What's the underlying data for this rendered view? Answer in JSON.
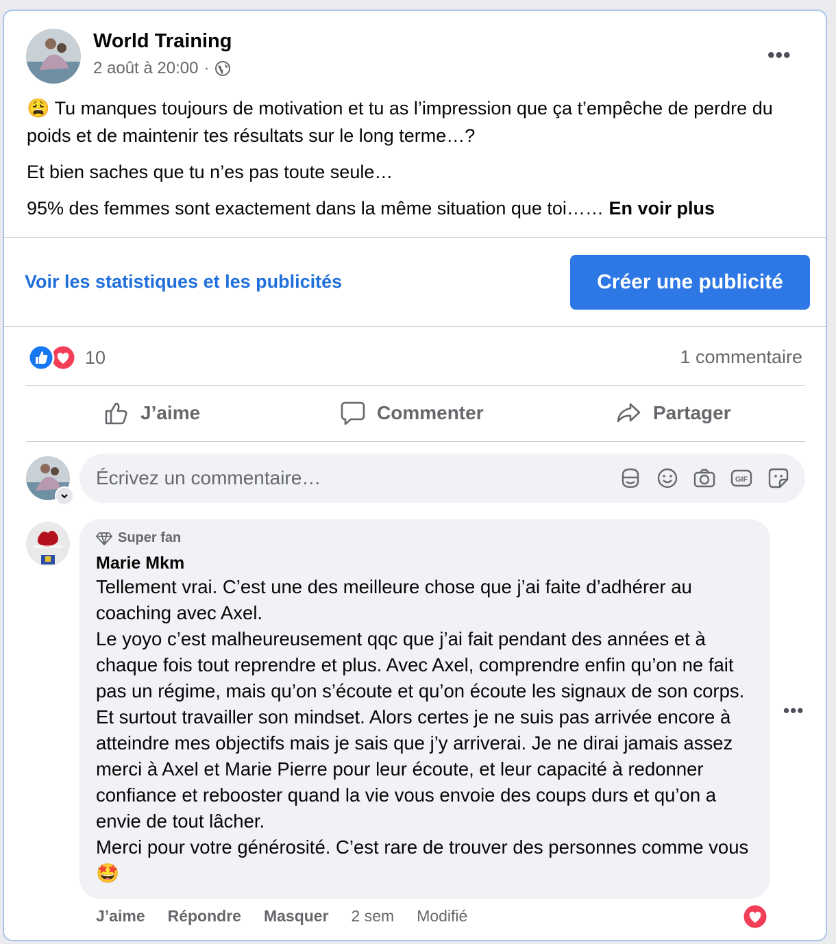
{
  "post": {
    "page_name": "World Training",
    "date": "2 août à 20:00",
    "separator": "·",
    "more_icon": "•••",
    "emoji_start": "😩",
    "paragraphs": [
      " Tu manques toujours de motivation et tu as l’impression que ça t’empêche de perdre du poids et de maintenir tes résultats sur le long terme…?",
      "Et bien saches que tu n’es pas toute seule…",
      "95% des femmes sont exactement dans la même situation que toi……"
    ],
    "see_more": "En voir plus"
  },
  "promo": {
    "stats_link": "Voir les statistiques et les publicités",
    "create_ad_button": "Créer une publicité"
  },
  "reactions": {
    "count": "10",
    "comments_count": "1 commentaire"
  },
  "actions": {
    "like": "J’aime",
    "comment": "Commenter",
    "share": "Partager"
  },
  "composer": {
    "placeholder": "Écrivez un commentaire…"
  },
  "comment": {
    "badge": "Super fan",
    "author": "Marie Mkm",
    "text": "Tellement vrai. C’est une des meilleure chose que j’ai faite d’adhérer au coaching avec Axel.\nLe yoyo c’est malheureusement qqc que j’ai fait pendant des années et à chaque fois tout reprendre et plus. Avec Axel, comprendre enfin qu’on ne fait pas un régime, mais qu’on s’écoute et qu’on écoute les signaux de son corps. Et surtout travailler son mindset. Alors certes je ne suis pas arrivée encore à atteindre mes objectifs mais je sais que j’y arriverai. Je ne dirai jamais assez merci à Axel et Marie Pierre pour leur écoute, et leur capacité à redonner confiance et rebooster quand la vie vous envoie des coups durs et qu’on a envie de tout lâcher.\nMerci pour votre générosité. C’est rare de trouver des personnes comme vous",
    "emoji_end": "🤩",
    "like": "J’aime",
    "reply": "Répondre",
    "hide": "Masquer",
    "time": "2 sem",
    "edited": "Modifié",
    "more_icon": "•••"
  },
  "colors": {
    "accent": "#2d78e5",
    "link": "#216fdb",
    "like_blue": "#1877f2",
    "love_red": "#f33e58"
  }
}
